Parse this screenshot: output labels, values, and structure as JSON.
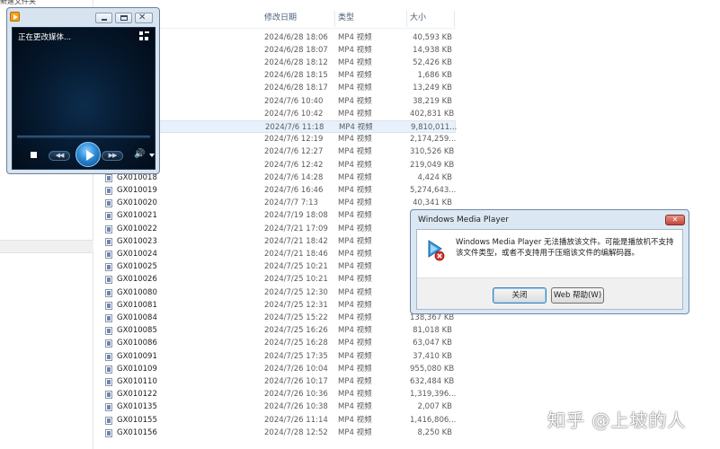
{
  "explorer": {
    "window_title_fragment": "新建文件夹",
    "columns": {
      "date": "修改日期",
      "type": "类型",
      "size": "大小"
    },
    "files": [
      {
        "name": "",
        "date": "2024/6/28 18:06",
        "type": "MP4 视频",
        "size": "40,593 KB"
      },
      {
        "name": "",
        "date": "2024/6/28 18:07",
        "type": "MP4 视频",
        "size": "14,938 KB"
      },
      {
        "name": "",
        "date": "2024/6/28 18:12",
        "type": "MP4 视频",
        "size": "52,426 KB"
      },
      {
        "name": "",
        "date": "2024/6/28 18:15",
        "type": "MP4 视频",
        "size": "1,686 KB"
      },
      {
        "name": "",
        "date": "2024/6/28 18:17",
        "type": "MP4 视频",
        "size": "13,249 KB"
      },
      {
        "name": "",
        "date": "2024/7/6 10:40",
        "type": "MP4 视频",
        "size": "38,219 KB"
      },
      {
        "name": "",
        "date": "2024/7/6 10:42",
        "type": "MP4 视频",
        "size": "402,831 KB"
      },
      {
        "name": "",
        "date": "2024/7/6 11:18",
        "type": "MP4 视频",
        "size": "9,810,011..."
      },
      {
        "name": "",
        "date": "2024/7/6 12:19",
        "type": "MP4 视频",
        "size": "2,174,259..."
      },
      {
        "name": "",
        "date": "2024/7/6 12:27",
        "type": "MP4 视频",
        "size": "310,526 KB"
      },
      {
        "name": "",
        "date": "2024/7/6 12:42",
        "type": "MP4 视频",
        "size": "219,049 KB"
      },
      {
        "name": "GX010018",
        "date": "2024/7/6 14:28",
        "type": "MP4 视频",
        "size": "4,424 KB"
      },
      {
        "name": "GX010019",
        "date": "2024/7/6 16:46",
        "type": "MP4 视频",
        "size": "5,274,643..."
      },
      {
        "name": "GX010020",
        "date": "2024/7/7 7:13",
        "type": "MP4 视频",
        "size": "40,341 KB"
      },
      {
        "name": "GX010021",
        "date": "2024/7/19 18:08",
        "type": "MP4 视频",
        "size": ""
      },
      {
        "name": "GX010022",
        "date": "2024/7/21 17:09",
        "type": "MP4 视频",
        "size": ""
      },
      {
        "name": "GX010023",
        "date": "2024/7/21 18:42",
        "type": "MP4 视频",
        "size": ""
      },
      {
        "name": "GX010024",
        "date": "2024/7/21 18:46",
        "type": "MP4 视频",
        "size": ""
      },
      {
        "name": "GX010025",
        "date": "2024/7/25 10:21",
        "type": "MP4 视频",
        "size": ""
      },
      {
        "name": "GX010026",
        "date": "2024/7/25 10:21",
        "type": "MP4 视频",
        "size": ""
      },
      {
        "name": "GX010080",
        "date": "2024/7/25 12:30",
        "type": "MP4 视频",
        "size": ""
      },
      {
        "name": "GX010081",
        "date": "2024/7/25 12:31",
        "type": "MP4 视频",
        "size": ""
      },
      {
        "name": "GX010084",
        "date": "2024/7/25 15:22",
        "type": "MP4 视频",
        "size": "138,367 KB"
      },
      {
        "name": "GX010085",
        "date": "2024/7/25 16:26",
        "type": "MP4 视频",
        "size": "81,018 KB"
      },
      {
        "name": "GX010086",
        "date": "2024/7/25 16:28",
        "type": "MP4 视频",
        "size": "63,047 KB"
      },
      {
        "name": "GX010091",
        "date": "2024/7/25 17:35",
        "type": "MP4 视频",
        "size": "37,410 KB"
      },
      {
        "name": "GX010109",
        "date": "2024/7/26 10:04",
        "type": "MP4 视频",
        "size": "955,080 KB"
      },
      {
        "name": "GX010110",
        "date": "2024/7/26 10:17",
        "type": "MP4 视频",
        "size": "632,484 KB"
      },
      {
        "name": "GX010122",
        "date": "2024/7/26 10:36",
        "type": "MP4 视频",
        "size": "1,319,396..."
      },
      {
        "name": "GX010135",
        "date": "2024/7/26 10:38",
        "type": "MP4 视频",
        "size": "2,007 KB"
      },
      {
        "name": "GX010155",
        "date": "2024/7/26 11:14",
        "type": "MP4 视频",
        "size": "1,416,806..."
      },
      {
        "name": "GX010156",
        "date": "2024/7/28 12:52",
        "type": "MP4 视频",
        "size": "8,250 KB"
      }
    ],
    "selected_row": 7
  },
  "player": {
    "status_text": "正在更改媒体...",
    "buttons": {
      "minimize": "",
      "maximize": "",
      "close": "✕"
    },
    "controls": {
      "prev": "◀◀",
      "next": "▶▶",
      "volume": "🔊"
    }
  },
  "dialog": {
    "title": "Windows Media Player",
    "close_glyph": "✕",
    "message": "Windows Media Player 无法播放该文件。可能是播放机不支持该文件类型，或者不支持用于压缩该文件的编解码器。",
    "close_button": "关闭",
    "help_button": "Web 帮助(W)"
  },
  "watermark": "知乎 @上坡的人",
  "colors": {
    "accent": "#3c7fb1",
    "player_bg": "#061a30",
    "play_button": "#2b8ad6",
    "dialog_frame": "#dbe7f3",
    "error_red": "#c3473a"
  }
}
